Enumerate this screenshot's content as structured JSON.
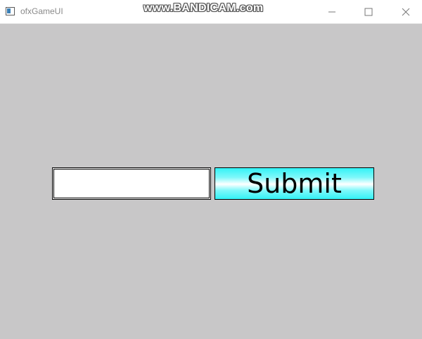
{
  "window": {
    "title": "ofxGameUI",
    "watermark": "www.BANDICAM.com",
    "background_color": "#c8c7c8",
    "controls": {
      "minimize": "minimize-icon",
      "maximize": "maximize-icon",
      "close": "close-icon"
    }
  },
  "form": {
    "input_value": "",
    "submit_label": "Submit",
    "submit_color": "#33f2f6"
  }
}
